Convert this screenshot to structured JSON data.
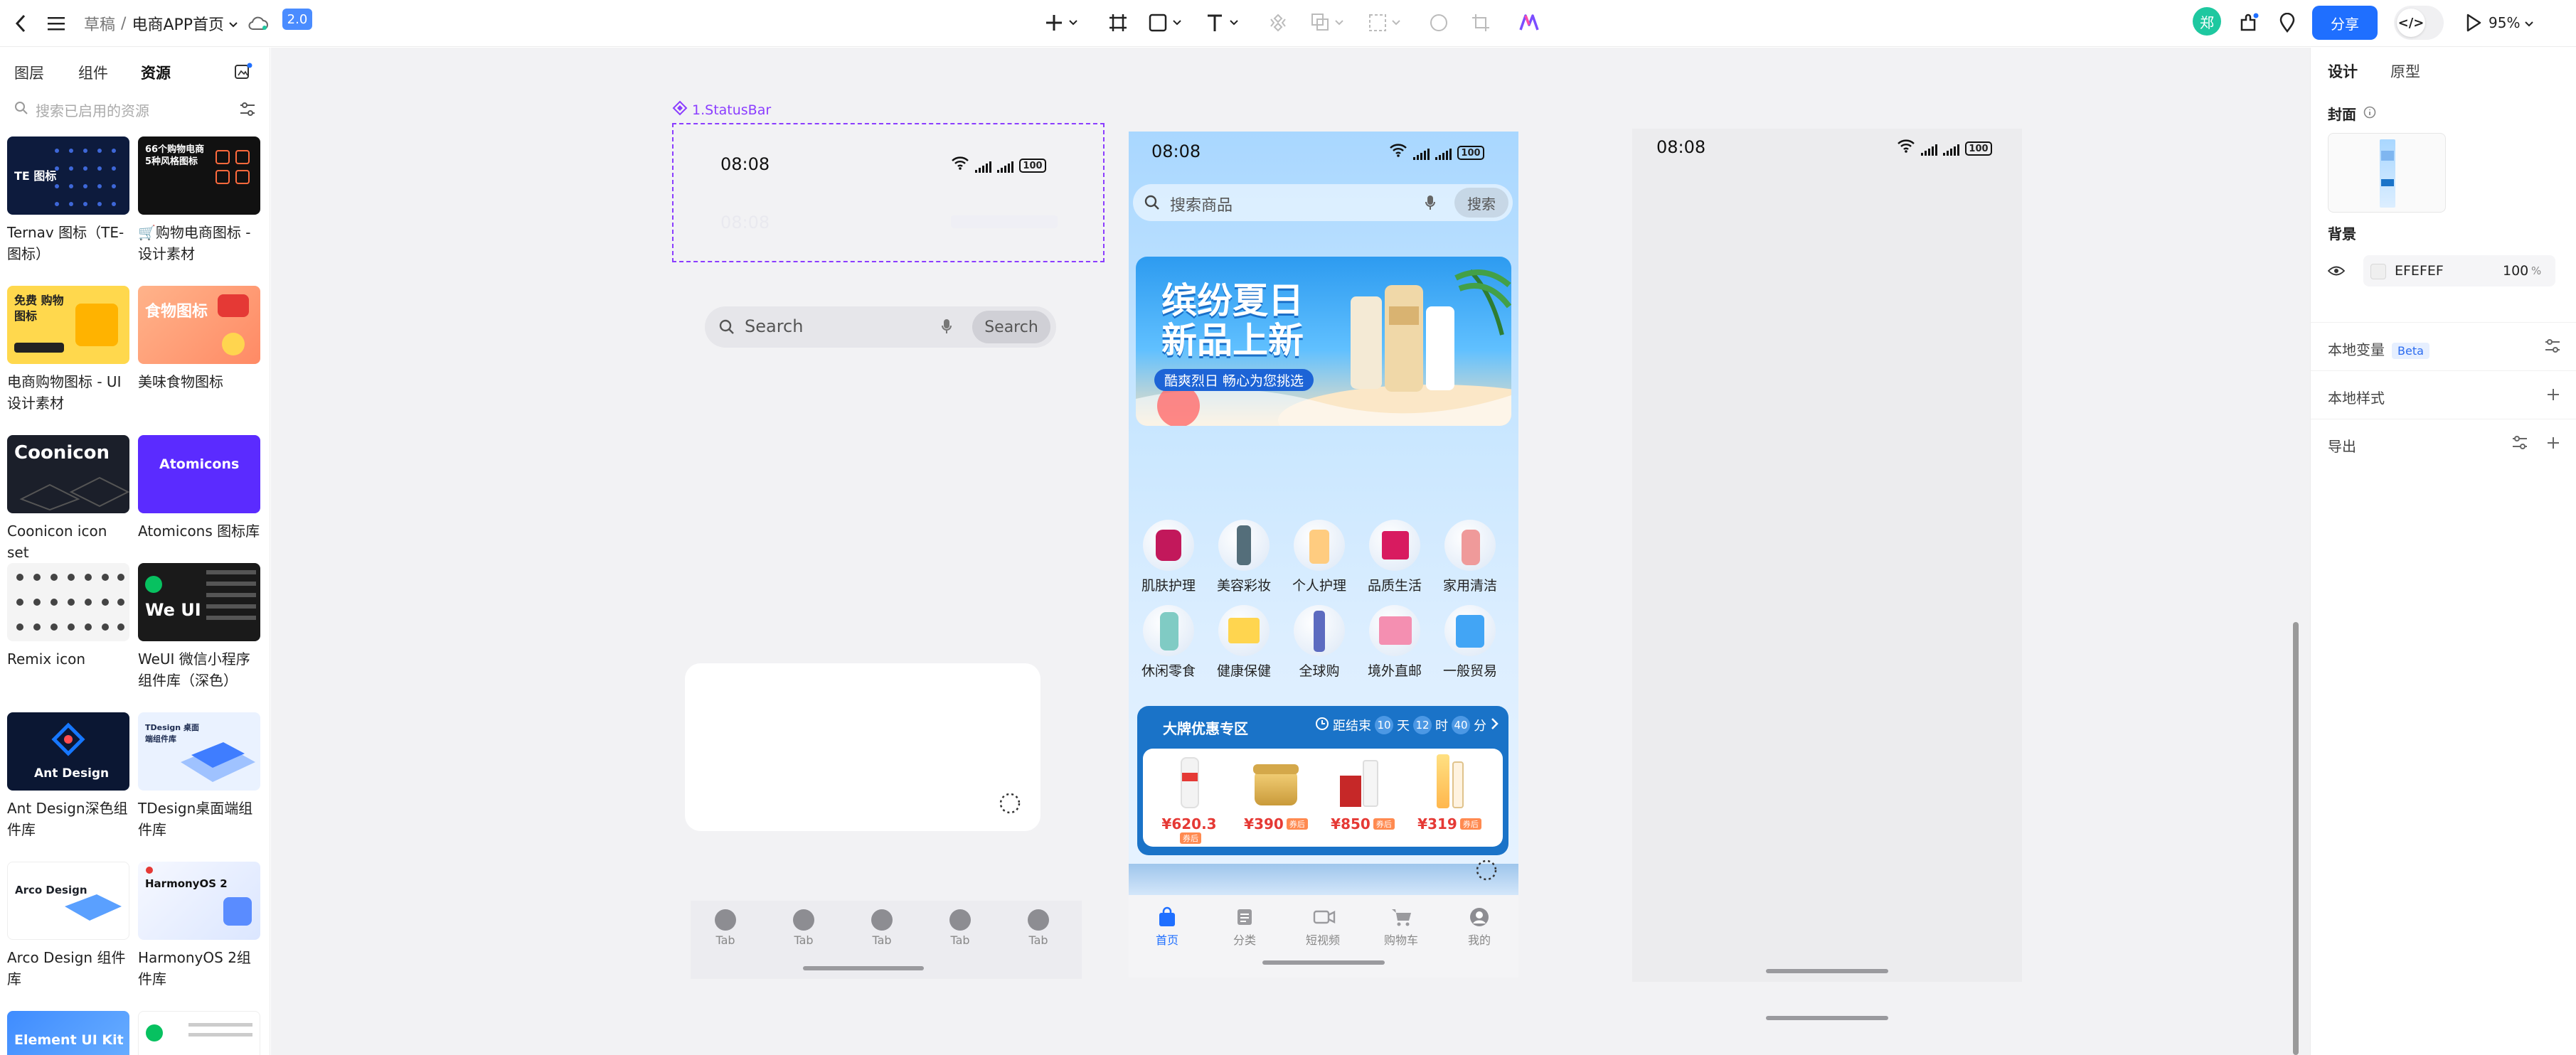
{
  "topbar": {
    "breadcrumb_parent": "草稿",
    "breadcrumb_sep": "/",
    "file_name": "电商APP首页",
    "version_badge": "2.0",
    "share_label": "分享",
    "avatar_initial": "郑",
    "zoom_label": "95%",
    "code_toggle": "</>"
  },
  "left_panel": {
    "tabs": [
      "图层",
      "组件",
      "资源"
    ],
    "active_tab": "资源",
    "search_placeholder": "搜索已启用的资源",
    "items": [
      {
        "label": "Ternav 图标（TE-图标）",
        "thumb_text": "TE 图标"
      },
      {
        "label": "🛒购物电商图标 - 设计素材",
        "thumb_text": "66个购物电商 5种风格图标"
      },
      {
        "label": "电商购物图标 - UI设计素材",
        "thumb_text": "免费 购物图标"
      },
      {
        "label": "美味食物图标",
        "thumb_text": "食物图标"
      },
      {
        "label": "Coonicon icon set",
        "thumb_text": "Coonicon"
      },
      {
        "label": "Atomicons 图标库",
        "thumb_text": "Atomicons"
      },
      {
        "label": "Remix icon",
        "thumb_text": ""
      },
      {
        "label": "WeUI 微信小程序组件库（深色）",
        "thumb_text": "We UI"
      },
      {
        "label": "Ant Design深色组件库",
        "thumb_text": "Ant Design"
      },
      {
        "label": "TDesign桌面端组件库",
        "thumb_text": "TDesign 桌面端组件库"
      },
      {
        "label": "Arco Design 组件库",
        "thumb_text": "Arco Design"
      },
      {
        "label": "HarmonyOS 2组件库",
        "thumb_text": "HarmonyOS 2"
      },
      {
        "label": "",
        "thumb_text": "Element UI Kit"
      },
      {
        "label": "",
        "thumb_text": ""
      }
    ]
  },
  "canvas": {
    "frame1": {
      "label": "1.StatusBar",
      "time": "08:08",
      "time_ghost": "08:08",
      "battery": "100",
      "search_placeholder": "Search",
      "search_button": "Search",
      "tabs": [
        "Tab",
        "Tab",
        "Tab",
        "Tab",
        "Tab"
      ]
    },
    "frame2": {
      "time": "08:08",
      "battery": "100",
      "search_placeholder": "搜索商品",
      "search_button": "搜索",
      "banner_title_line1": "缤纷夏日",
      "banner_title_line2": "新品上新",
      "banner_sub": "酷爽烈日 畅心为您挑选",
      "categories": [
        "肌肤护理",
        "美容彩妆",
        "个人护理",
        "品质生活",
        "家用清洁",
        "休闲零食",
        "健康保健",
        "全球购",
        "境外直邮",
        "一般贸易"
      ],
      "promo": {
        "title": "大牌优惠专区",
        "countdown_prefix": "距结束",
        "days": "10",
        "days_unit": "天",
        "hours": "12",
        "hours_unit": "时",
        "minutes": "40",
        "minutes_unit": "分",
        "products": [
          {
            "price": "¥620.3",
            "tag": "券后"
          },
          {
            "price": "¥390",
            "tag": "券后"
          },
          {
            "price": "¥850",
            "tag": "券后"
          },
          {
            "price": "¥319",
            "tag": "券后"
          }
        ]
      },
      "tabbar": [
        "首页",
        "分类",
        "短视频",
        "购物车",
        "我的"
      ]
    },
    "frame3": {
      "time": "08:08",
      "battery": "100"
    }
  },
  "right_panel": {
    "tabs": [
      "设计",
      "原型"
    ],
    "cover_label": "封面",
    "background_label": "背景",
    "background_hex": "EFEFEF",
    "background_opacity": "100",
    "opacity_unit": "%",
    "local_vars_label": "本地变量",
    "beta_label": "Beta",
    "local_styles_label": "本地样式",
    "export_label": "导出"
  },
  "colors": {
    "accent": "#1f6fff",
    "canvas_bg": "#f2f2f4",
    "selection": "#8b3dff",
    "promo_blue": "#1a73c8",
    "price_red": "#e53935"
  }
}
